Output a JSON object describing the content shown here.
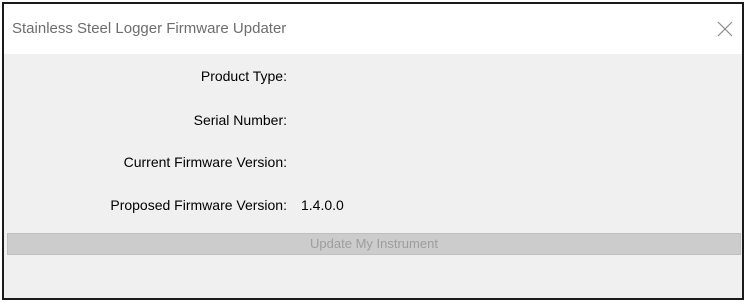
{
  "window": {
    "title": "Stainless Steel Logger Firmware Updater"
  },
  "fields": [
    {
      "label": "Product Type:",
      "value": ""
    },
    {
      "label": "Serial Number:",
      "value": ""
    },
    {
      "label": "Current Firmware Version:",
      "value": ""
    },
    {
      "label": "Proposed Firmware Version:",
      "value": "1.4.0.0"
    }
  ],
  "actions": {
    "update_label": "Update My Instrument",
    "update_enabled": false
  },
  "icons": {
    "close": "close-icon"
  },
  "colors": {
    "titlebar_bg": "#ffffff",
    "client_bg": "#f0f0f0",
    "border": "#1a1a1a",
    "disabled_button_bg": "#cccccc",
    "disabled_button_text": "#9d9d9d"
  }
}
